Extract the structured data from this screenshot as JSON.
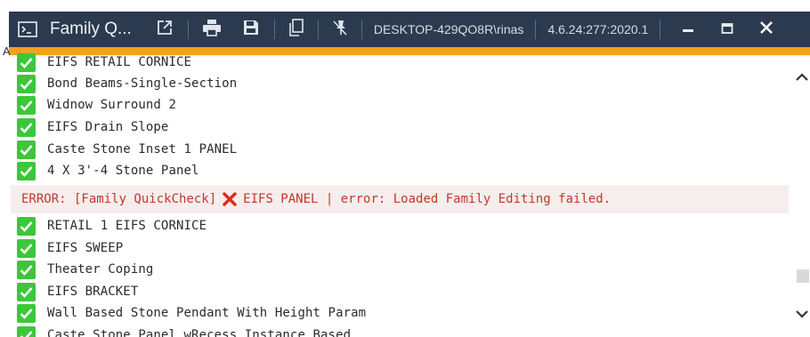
{
  "window": {
    "title": "Family Q...",
    "machine_user": "DESKTOP-429QO8R\\rinas",
    "version": "4.6.24:277:2020.1"
  },
  "stray_char": "A",
  "log": {
    "items_before_error": [
      "EIFS RETAIL CORNICE",
      "Bond Beams-Single-Section",
      "Widnow Surround 2",
      "EIFS Drain Slope",
      "Caste Stone Inset 1 PANEL",
      "4 X 3'-4 Stone Panel"
    ],
    "error": {
      "prefix": "ERROR: [Family QuickCheck]",
      "message": "EIFS PANEL | error: Loaded Family Editing failed."
    },
    "items_after_error": [
      "RETAIL 1 EIFS CORNICE",
      "EIFS SWEEP",
      "Theater Coping",
      "EIFS BRACKET",
      "Wall Based Stone Pendant With Height Param",
      "Caste Stone Panel wRecess Instance Based"
    ]
  },
  "colors": {
    "titlebar_bg": "#2b3a4e",
    "accent": "#f4a11c",
    "success": "#3ec63b",
    "error_text": "#c0392b",
    "error_bg": "#f6eded"
  },
  "icons": {
    "app": "terminal-icon",
    "open_external": "external-link-icon",
    "print": "printer-icon",
    "save": "save-icon",
    "copy": "copy-icon",
    "pin": "unpin-icon",
    "minimize": "minimize-icon",
    "maximize": "maximize-icon",
    "close": "close-icon",
    "ok": "check-icon",
    "error": "error-x-icon"
  }
}
